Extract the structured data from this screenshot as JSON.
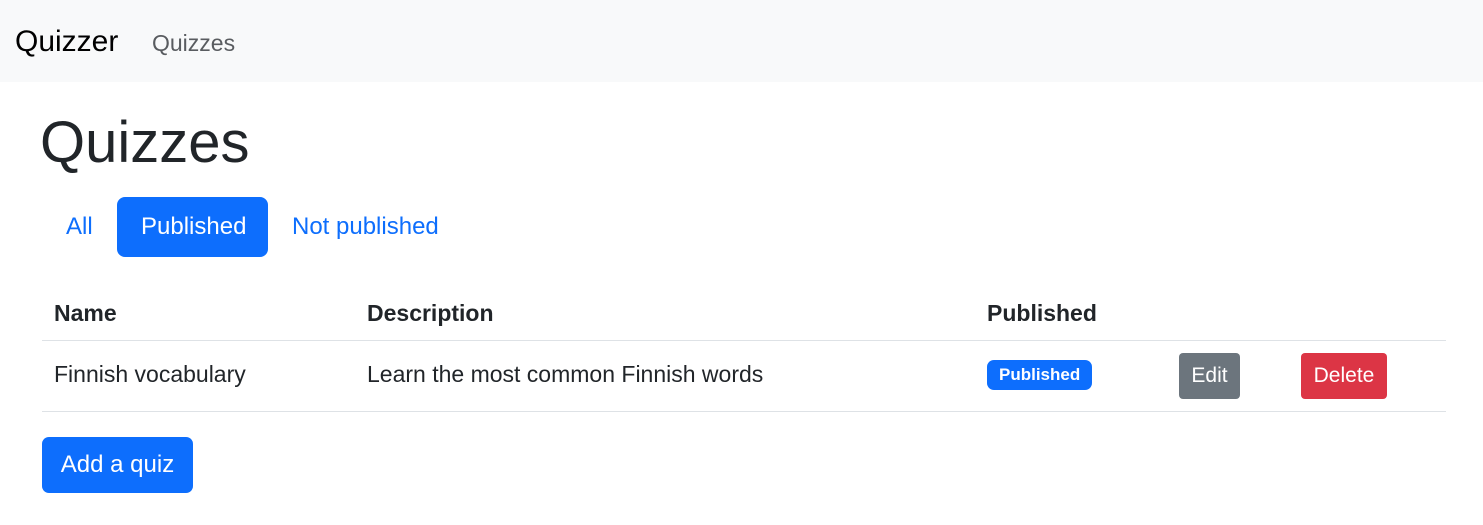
{
  "navbar": {
    "brand": "Quizzer",
    "links": [
      "Quizzes"
    ]
  },
  "page": {
    "title": "Quizzes"
  },
  "filters": {
    "tabs": [
      "All",
      "Published",
      "Not published"
    ],
    "active": "Published"
  },
  "table": {
    "headers": [
      "Name",
      "Description",
      "Published"
    ],
    "rows": [
      {
        "name": "Finnish vocabulary",
        "description": "Learn the most common Finnish words",
        "status": "Published",
        "edit_label": "Edit",
        "delete_label": "Delete"
      }
    ]
  },
  "actions": {
    "add_label": "Add a quiz"
  },
  "colors": {
    "primary": "#0d6efd",
    "secondary": "#6c757d",
    "danger": "#dc3545",
    "navbar_bg": "#f8f9fa"
  }
}
